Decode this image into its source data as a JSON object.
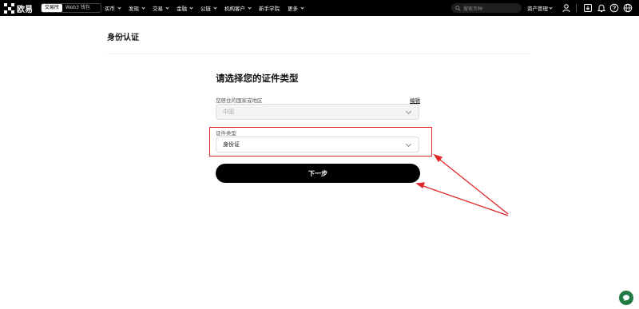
{
  "topbar": {
    "brand": "欧易",
    "switch": {
      "exchange": "交易所",
      "web3": "Web3 钱包"
    },
    "nav": [
      {
        "label": "买币"
      },
      {
        "label": "发现"
      },
      {
        "label": "交易"
      },
      {
        "label": "金融"
      },
      {
        "label": "公链"
      },
      {
        "label": "机构客户"
      },
      {
        "label": "新手学院"
      },
      {
        "label": "更多"
      }
    ],
    "search_placeholder": "搜索币种",
    "asset_menu": "资产管理",
    "icons": [
      "user-icon",
      "download-icon",
      "bell-icon",
      "help-icon",
      "globe-icon"
    ]
  },
  "page": {
    "title": "身份认证"
  },
  "form": {
    "title": "请选择您的证件类型",
    "country_label": "您居住的国家或地区",
    "edit_label": "编辑",
    "country_value": "中国",
    "doc_type_label": "证件类型",
    "doc_type_value": "身份证",
    "next_button": "下一步"
  },
  "annotation": {
    "highlight_color": "#e0282a"
  },
  "chat_icon": "chat-bubble-icon"
}
